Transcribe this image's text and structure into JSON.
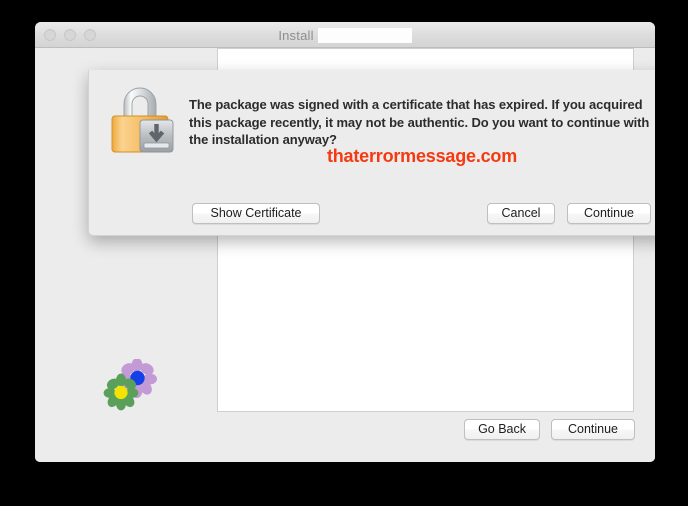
{
  "window": {
    "title": "Install",
    "title_redacted_value": "",
    "traffic_lights": [
      "close",
      "minimize",
      "zoom"
    ]
  },
  "sheet": {
    "icon": "certificate-lock-icon",
    "message": "The package was signed with a certificate that has expired. If you acquired this package recently, it may not be authentic. Do you want to continue with the installation anyway?",
    "watermark": "thaterrormessage.com",
    "watermark_color": "#f53a12",
    "buttons": {
      "show_certificate": "Show Certificate",
      "cancel": "Cancel",
      "continue": "Continue"
    }
  },
  "main": {
    "brand_icon": "flowers-icon",
    "footer_buttons": {
      "go_back": "Go Back",
      "continue": "Continue"
    }
  }
}
